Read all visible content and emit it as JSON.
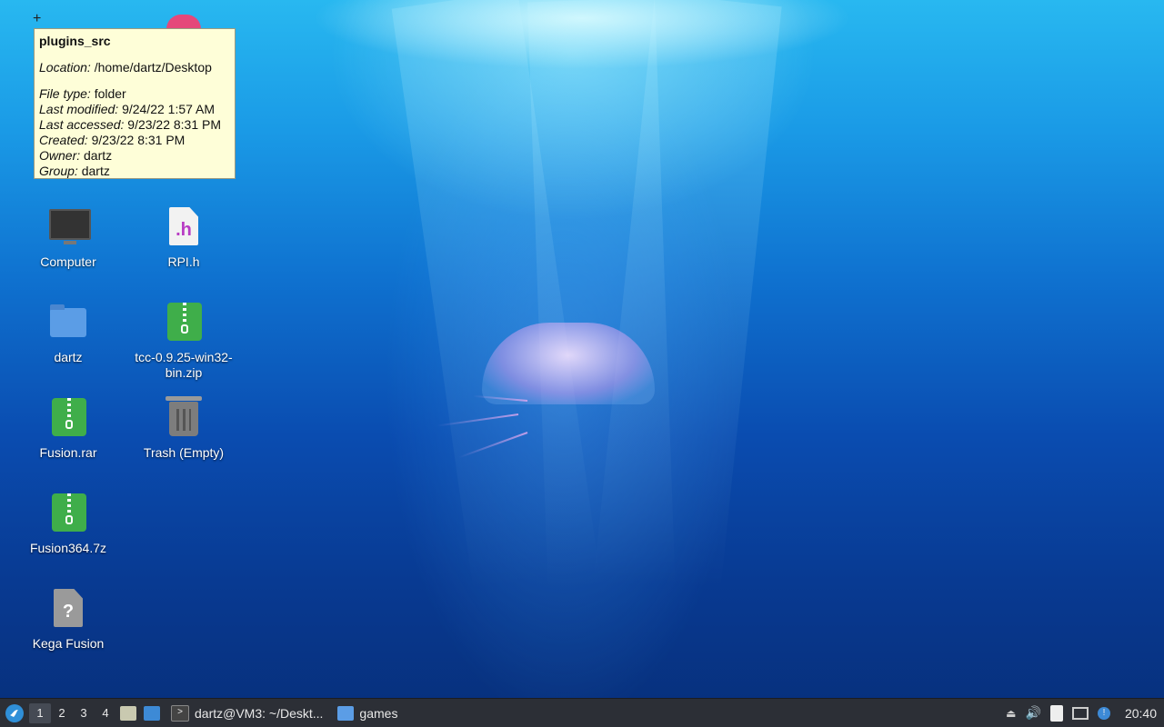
{
  "desktop": {
    "icons": {
      "computer": "Computer",
      "rpi": "RPI.h",
      "dartz": "dartz",
      "tcc": "tcc-0.9.25-win32-bin.zip",
      "fusion_rar": "Fusion.rar",
      "trash": "Trash (Empty)",
      "fusion364": "Fusion364.7z",
      "kega": "Kega Fusion"
    }
  },
  "tooltip": {
    "title": "plugins_src",
    "location_label": "Location:",
    "location": "/home/dartz/Desktop",
    "filetype_label": "File type:",
    "filetype": "folder",
    "modified_label": "Last modified:",
    "modified": "9/24/22 1:57 AM",
    "accessed_label": "Last accessed:",
    "accessed": "9/23/22 8:31 PM",
    "created_label": "Created:",
    "created": "9/23/22 8:31 PM",
    "owner_label": "Owner:",
    "owner": "dartz",
    "group_label": "Group:",
    "group": "dartz"
  },
  "taskbar": {
    "workspaces": [
      "1",
      "2",
      "3",
      "4"
    ],
    "active_workspace": "1",
    "terminal_window": "dartz@VM3: ~/Deskt...",
    "files_window": "games",
    "clock": "20:40"
  },
  "colors": {
    "taskbar_bg": "#2c2f36",
    "tooltip_bg": "#fefed8",
    "accent": "#5b9de6"
  }
}
